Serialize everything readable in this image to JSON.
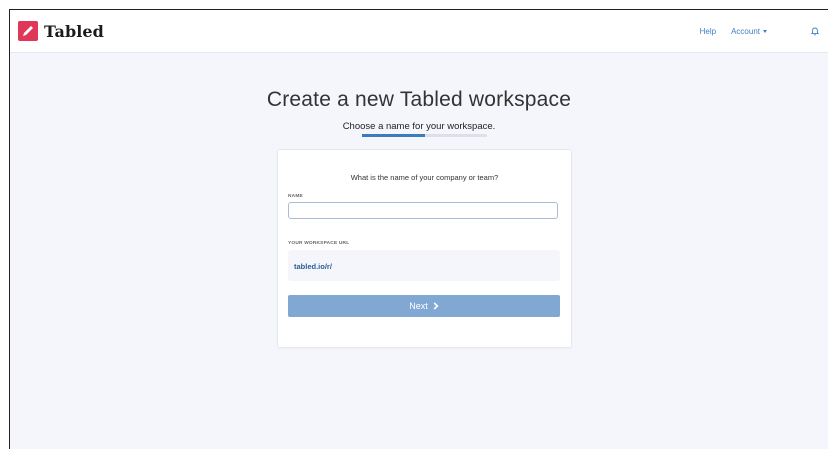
{
  "brand": {
    "name": "Tabled",
    "color": "#e0365a",
    "logo_icon": "pencil-icon"
  },
  "nav": {
    "help": "Help",
    "account": "Account",
    "bell_icon": "bell-icon"
  },
  "page": {
    "title": "Create a new Tabled workspace",
    "subtitle": "Choose a name for your workspace.",
    "progress": 0.5
  },
  "form": {
    "question": "What is the name of your company or team?",
    "name_label": "NAME",
    "name_value": "",
    "name_placeholder": "",
    "url_label": "YOUR WORKSPACE URL",
    "url_value": "tabled.io/r/",
    "next_label": "Next"
  },
  "colors": {
    "accent": "#3d7cbc",
    "button": "#80a8d2",
    "background": "#f4f6fc"
  }
}
